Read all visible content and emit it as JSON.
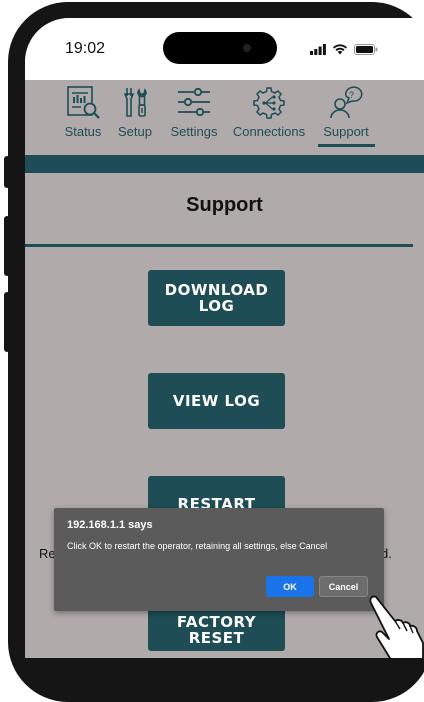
{
  "status_bar": {
    "time": "19:02"
  },
  "nav": {
    "items": [
      {
        "label": "Status",
        "icon": "status-chart-icon"
      },
      {
        "label": "Setup",
        "icon": "tools-icon"
      },
      {
        "label": "Settings",
        "icon": "sliders-icon"
      },
      {
        "label": "Connections",
        "icon": "network-gear-icon"
      },
      {
        "label": "Support",
        "icon": "support-person-icon",
        "active": true
      }
    ]
  },
  "page": {
    "title": "Support",
    "buttons": {
      "download_log": "DOWNLOAD\nLOG",
      "view_log": "VIEW LOG",
      "restart": "RESTART",
      "factory_reset": "FACTORY RESET"
    },
    "partial_left_text": "Re",
    "partial_right_text": "d."
  },
  "dialog": {
    "title": "192.168.1.1 says",
    "message": "Click OK to restart the operator, retaining all settings, else Cancel",
    "ok_label": "OK",
    "cancel_label": "Cancel"
  },
  "colors": {
    "brand_teal": "#1e4d55",
    "screen_bg": "#b0aaab",
    "dialog_bg": "#5b5b5c",
    "ok_blue": "#1a73e8"
  }
}
